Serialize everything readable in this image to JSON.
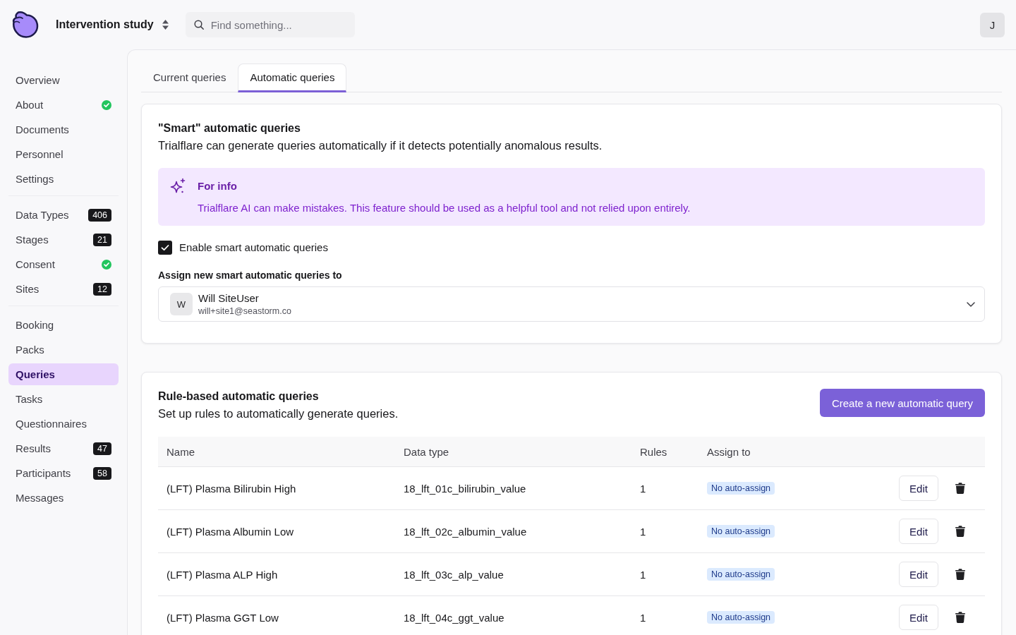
{
  "top_bar": {
    "study": "Intervention study",
    "search": {
      "placeholder": "Find something..."
    },
    "avatar": "J"
  },
  "sidebar": {
    "sections": [
      {
        "items": [
          {
            "label": "Overview",
            "selected": false,
            "done": false
          },
          {
            "label": "About",
            "selected": false,
            "done": true
          },
          {
            "label": "Documents",
            "selected": false,
            "done": false
          },
          {
            "label": "Personnel",
            "selected": false,
            "done": false
          },
          {
            "label": "Settings",
            "selected": false,
            "done": false
          }
        ]
      },
      {
        "items": [
          {
            "label": "Data Types",
            "selected": false,
            "done": false,
            "badge": "406"
          },
          {
            "label": "Stages",
            "selected": false,
            "done": false,
            "badge": "21"
          },
          {
            "label": "Consent",
            "selected": false,
            "done": true
          },
          {
            "label": "Sites",
            "selected": false,
            "done": false,
            "badge": "12"
          }
        ]
      },
      {
        "items": [
          {
            "label": "Booking",
            "selected": false,
            "done": false
          },
          {
            "label": "Packs",
            "selected": false,
            "done": false
          },
          {
            "label": "Queries",
            "selected": true,
            "done": false
          },
          {
            "label": "Tasks",
            "selected": false,
            "done": false
          },
          {
            "label": "Questionnaires",
            "selected": false,
            "done": false
          },
          {
            "label": "Results",
            "selected": false,
            "done": false,
            "badge": "47"
          },
          {
            "label": "Participants",
            "selected": false,
            "done": false,
            "badge": "58"
          },
          {
            "label": "Messages",
            "selected": false,
            "done": false
          }
        ]
      }
    ]
  },
  "tabs": [
    {
      "label": "Current queries",
      "selected": false
    },
    {
      "label": "Automatic queries",
      "selected": true
    }
  ],
  "smart_card": {
    "title": "\"Smart\" automatic queries",
    "description": "Trialflare can generate queries automatically if it detects potentially anomalous results.",
    "notice": {
      "title": "For info",
      "text": "Trialflare AI can make mistakes. This feature should be used as a helpful tool and not relied upon entirely."
    },
    "enable": {
      "label": "Enable smart automatic queries",
      "checked": true
    },
    "assign": {
      "label": "Assign new smart automatic queries to",
      "user": {
        "initial": "W",
        "name": "Will SiteUser",
        "email": "will+site1@seastorm.co"
      }
    }
  },
  "rules_card": {
    "title": "Rule-based automatic queries",
    "description": "Set up rules to automatically generate queries.",
    "create_button": "Create a new automatic query",
    "table": {
      "columns": [
        "Name",
        "Data type",
        "Rules",
        "Assign to"
      ],
      "rows": [
        {
          "name": "(LFT) Plasma Bilirubin High",
          "data_type": "18_lft_01c_bilirubin_value",
          "rules": "1",
          "assign_to": "No auto-assign",
          "edit": "Edit"
        },
        {
          "name": "(LFT) Plasma Albumin Low",
          "data_type": "18_lft_02c_albumin_value",
          "rules": "1",
          "assign_to": "No auto-assign",
          "edit": "Edit"
        },
        {
          "name": "(LFT) Plasma ALP High",
          "data_type": "18_lft_03c_alp_value",
          "rules": "1",
          "assign_to": "No auto-assign",
          "edit": "Edit"
        },
        {
          "name": "(LFT) Plasma GGT Low",
          "data_type": "18_lft_04c_ggt_value",
          "rules": "1",
          "assign_to": "No auto-assign",
          "edit": "Edit"
        }
      ]
    }
  }
}
